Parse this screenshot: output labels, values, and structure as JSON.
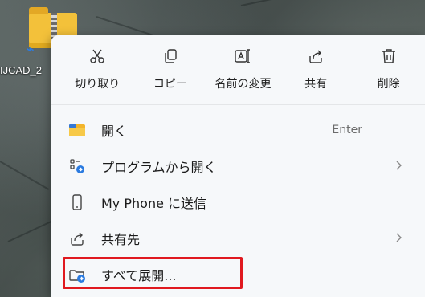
{
  "desktop": {
    "file_label": "IJCAD_2",
    "app_tag_icon": "app-badge-icon"
  },
  "toolbar": {
    "cut_label": "切り取り",
    "copy_label": "コピー",
    "rename_label": "名前の変更",
    "share_label": "共有",
    "delete_label": "削除"
  },
  "menu": {
    "items": [
      {
        "label": "開く",
        "shortcut": "Enter",
        "icon": "folder-open-icon"
      },
      {
        "label": "プログラムから開く",
        "icon": "open-with-icon",
        "submenu": true
      },
      {
        "label": "My Phone に送信",
        "icon": "phone-icon"
      },
      {
        "label": "共有先",
        "icon": "share-icon",
        "submenu": true
      },
      {
        "label": "すべて展開...",
        "icon": "extract-all-icon",
        "highlighted": true
      }
    ]
  },
  "colors": {
    "menu_bg": "#f6f8fa",
    "highlight": "#e0191f",
    "folder": "#f3c13a",
    "accent": "#2b7be0"
  }
}
